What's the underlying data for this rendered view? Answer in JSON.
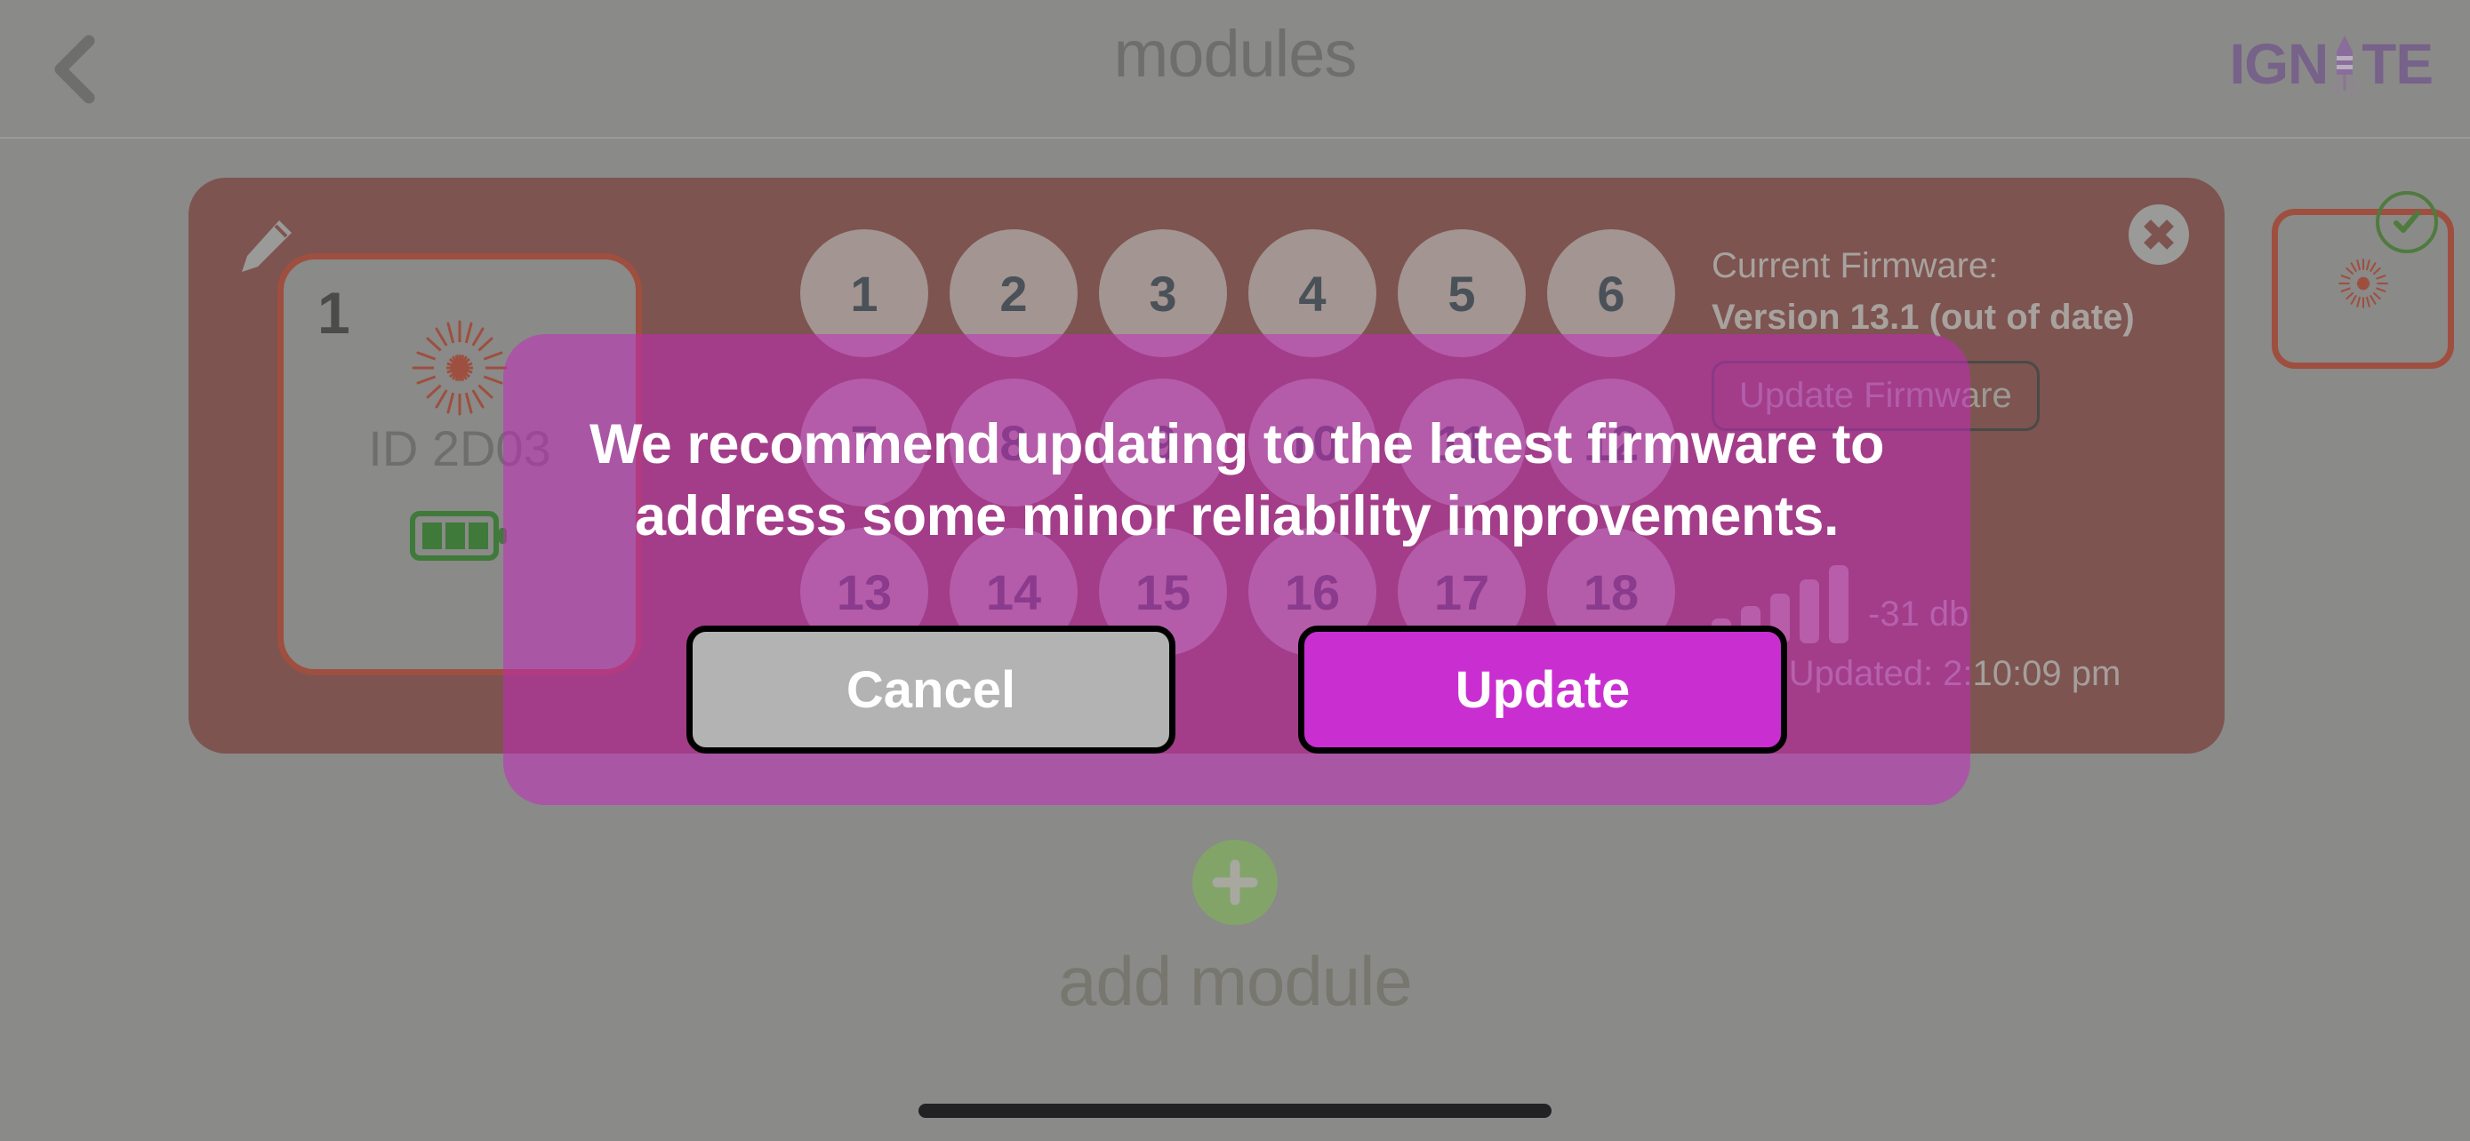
{
  "header": {
    "title": "modules",
    "back_icon": "chevron-left-icon",
    "brand": {
      "prefix": "IGN",
      "icon": "rocket-icon",
      "suffix": "TE",
      "color": "#6d4a8c"
    }
  },
  "module_panel": {
    "edit_icon": "pencil-icon",
    "close_icon": "close-circle-icon",
    "panel_color": "#7d5450",
    "accent_color": "#9e4f3f",
    "card": {
      "index": "1",
      "id_label": "ID 2D03",
      "firework_icon": "firework-icon",
      "battery_icon": "battery-icon",
      "battery_level": 3
    },
    "channels": [
      "1",
      "2",
      "3",
      "4",
      "5",
      "6",
      "7",
      "8",
      "9",
      "10",
      "11",
      "12",
      "13",
      "14",
      "15",
      "16",
      "17",
      "18"
    ],
    "firmware": {
      "label": "Current Firmware:",
      "version": "Version 13.1 (out of date)",
      "update_button": "Update Firmware"
    },
    "signal": {
      "icon": "signal-bars-icon",
      "value": "-31 db",
      "bar_heights": [
        28,
        42,
        56,
        72,
        88
      ]
    },
    "last_updated": "Last Updated: 2:10:09 pm"
  },
  "next_module": {
    "firework_icon": "firework-icon",
    "status_icon": "check-circle-icon",
    "status_color": "#4f7b3e"
  },
  "add_module": {
    "plus_icon": "plus-icon",
    "label": "add module",
    "circle_color": "#82a469"
  },
  "modal": {
    "message": "We recommend updating to the latest firmware to address some minor reliability improvements.",
    "cancel_label": "Cancel",
    "update_label": "Update",
    "background_color": "#c528be",
    "update_color": "#c92fd0",
    "cancel_color": "#b3b3b3"
  },
  "home_indicator": "home-indicator"
}
